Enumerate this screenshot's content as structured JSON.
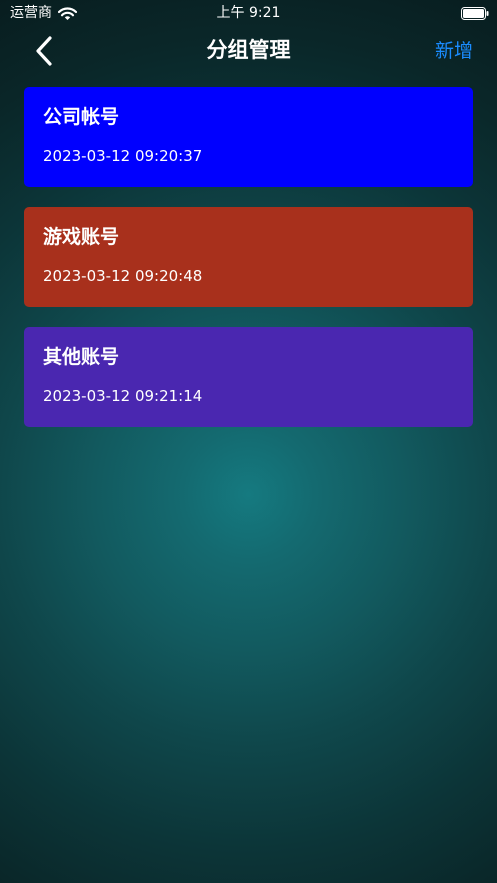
{
  "status_bar": {
    "carrier": "运营商",
    "time": "上午 9:21",
    "wifi_icon": "wifi-icon",
    "battery_icon": "battery-icon"
  },
  "nav": {
    "back_icon": "chevron-left-icon",
    "title": "分组管理",
    "add_label": "新增",
    "add_color": "#1a8cff"
  },
  "groups": [
    {
      "name": "公司帐号",
      "created": "2023-03-12 09:20:37",
      "color": "#0000ff"
    },
    {
      "name": "游戏账号",
      "created": "2023-03-12 09:20:48",
      "color": "#a8301c"
    },
    {
      "name": "其他账号",
      "created": "2023-03-12 09:21:14",
      "color": "#4a27b0"
    }
  ]
}
